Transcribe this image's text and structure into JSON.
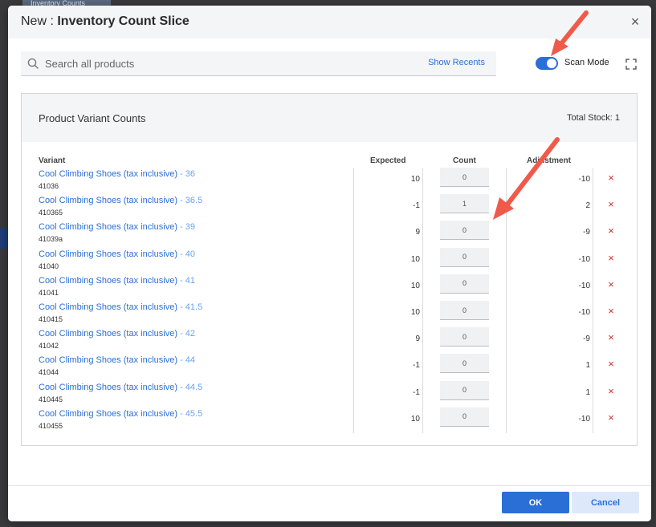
{
  "background": {
    "tab_label": "Inventory Counts"
  },
  "modal": {
    "title_prefix": "New : ",
    "title_main": "Inventory Count Slice",
    "close_symbol": "×"
  },
  "search": {
    "placeholder": "Search all products",
    "show_recents": "Show Recents",
    "icon": "search-icon"
  },
  "scan_mode": {
    "label": "Scan Mode",
    "enabled": true,
    "color": "#2a6fd6"
  },
  "panel": {
    "title": "Product Variant Counts",
    "total_stock": "Total Stock: 1",
    "columns": {
      "variant": "Variant",
      "expected": "Expected",
      "count": "Count",
      "adjustment": "Adjustment"
    }
  },
  "rows": [
    {
      "product": "Cool Climbing Shoes (tax inclusive)",
      "size": " - 36",
      "sku": "41036",
      "expected": "10",
      "count": "0",
      "adjustment": "-10"
    },
    {
      "product": "Cool Climbing Shoes (tax inclusive)",
      "size": " - 36.5",
      "sku": "410365",
      "expected": "-1",
      "count": "1",
      "adjustment": "2"
    },
    {
      "product": "Cool Climbing Shoes (tax inclusive)",
      "size": " - 39",
      "sku": "41039a",
      "expected": "9",
      "count": "0",
      "adjustment": "-9"
    },
    {
      "product": "Cool Climbing Shoes (tax inclusive)",
      "size": " - 40",
      "sku": "41040",
      "expected": "10",
      "count": "0",
      "adjustment": "-10"
    },
    {
      "product": "Cool Climbing Shoes (tax inclusive)",
      "size": " - 41",
      "sku": "41041",
      "expected": "10",
      "count": "0",
      "adjustment": "-10"
    },
    {
      "product": "Cool Climbing Shoes (tax inclusive)",
      "size": " - 41.5",
      "sku": "410415",
      "expected": "10",
      "count": "0",
      "adjustment": "-10"
    },
    {
      "product": "Cool Climbing Shoes (tax inclusive)",
      "size": " - 42",
      "sku": "41042",
      "expected": "9",
      "count": "0",
      "adjustment": "-9"
    },
    {
      "product": "Cool Climbing Shoes (tax inclusive)",
      "size": " - 44",
      "sku": "41044",
      "expected": "-1",
      "count": "0",
      "adjustment": "1"
    },
    {
      "product": "Cool Climbing Shoes (tax inclusive)",
      "size": " - 44.5",
      "sku": "410445",
      "expected": "-1",
      "count": "0",
      "adjustment": "1"
    },
    {
      "product": "Cool Climbing Shoes (tax inclusive)",
      "size": " - 45.5",
      "sku": "410455",
      "expected": "10",
      "count": "0",
      "adjustment": "-10"
    }
  ],
  "row_delete_symbol": "×",
  "footer": {
    "ok_label": "OK",
    "cancel_label": "Cancel"
  },
  "colors": {
    "primary": "#2a6fd6",
    "delete": "#d62b2b",
    "annotation_arrow": "#f05a4a"
  }
}
